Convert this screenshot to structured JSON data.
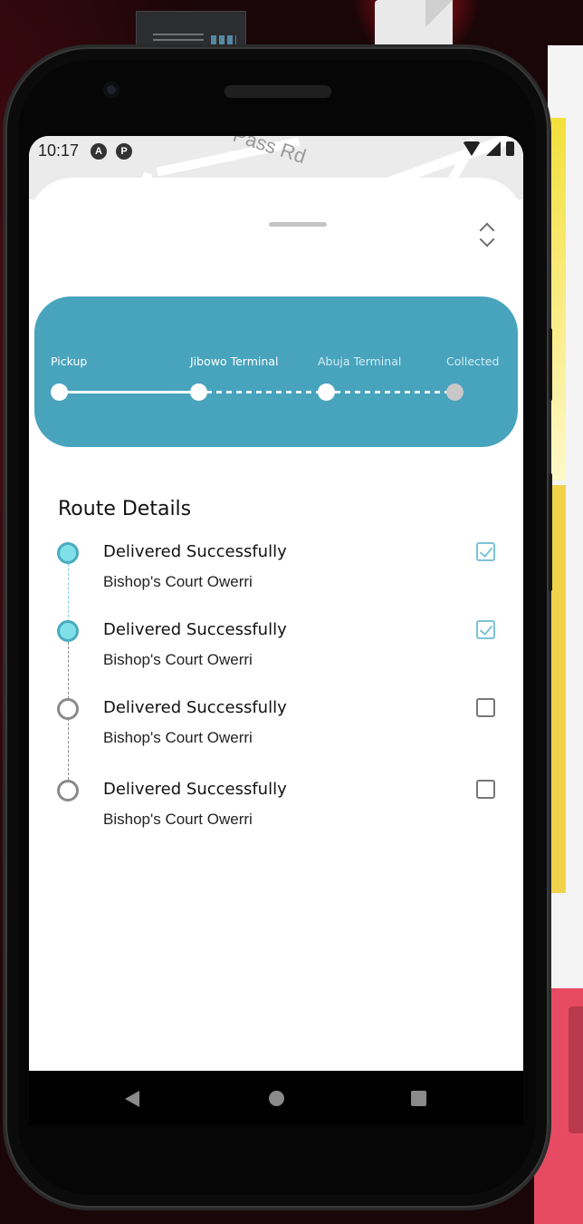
{
  "status_bar": {
    "time": "10:17",
    "icon_a": "A",
    "icon_b": "P"
  },
  "map": {
    "road_label": "Pass Rd"
  },
  "progress": {
    "stages": [
      {
        "label": "Pickup",
        "state": "done"
      },
      {
        "label": "Jibowo Terminal",
        "state": "current"
      },
      {
        "label": "Abuja Terminal",
        "state": "upcoming"
      },
      {
        "label": "Collected",
        "state": "pending"
      }
    ],
    "accent": "#48a3bd"
  },
  "route": {
    "title": "Route Details",
    "items": [
      {
        "title": "Delivered Successfully",
        "subtitle": "Bishop's Court Owerri",
        "checked": true
      },
      {
        "title": "Delivered Successfully",
        "subtitle": "Bishop's Court Owerri",
        "checked": true
      },
      {
        "title": "Delivered Successfully",
        "subtitle": "Bishop's Court Owerri",
        "checked": false
      },
      {
        "title": "Delivered Successfully",
        "subtitle": "Bishop's Court Owerri",
        "checked": false
      }
    ]
  },
  "colors": {
    "done_marker": "#7fe0ea",
    "pending_marker": "#8a8a8a",
    "check": "#7cc4d6"
  },
  "icons": {
    "expand": "chevron-up-down-icon",
    "nav": [
      "back-icon",
      "home-icon",
      "recents-icon"
    ]
  }
}
